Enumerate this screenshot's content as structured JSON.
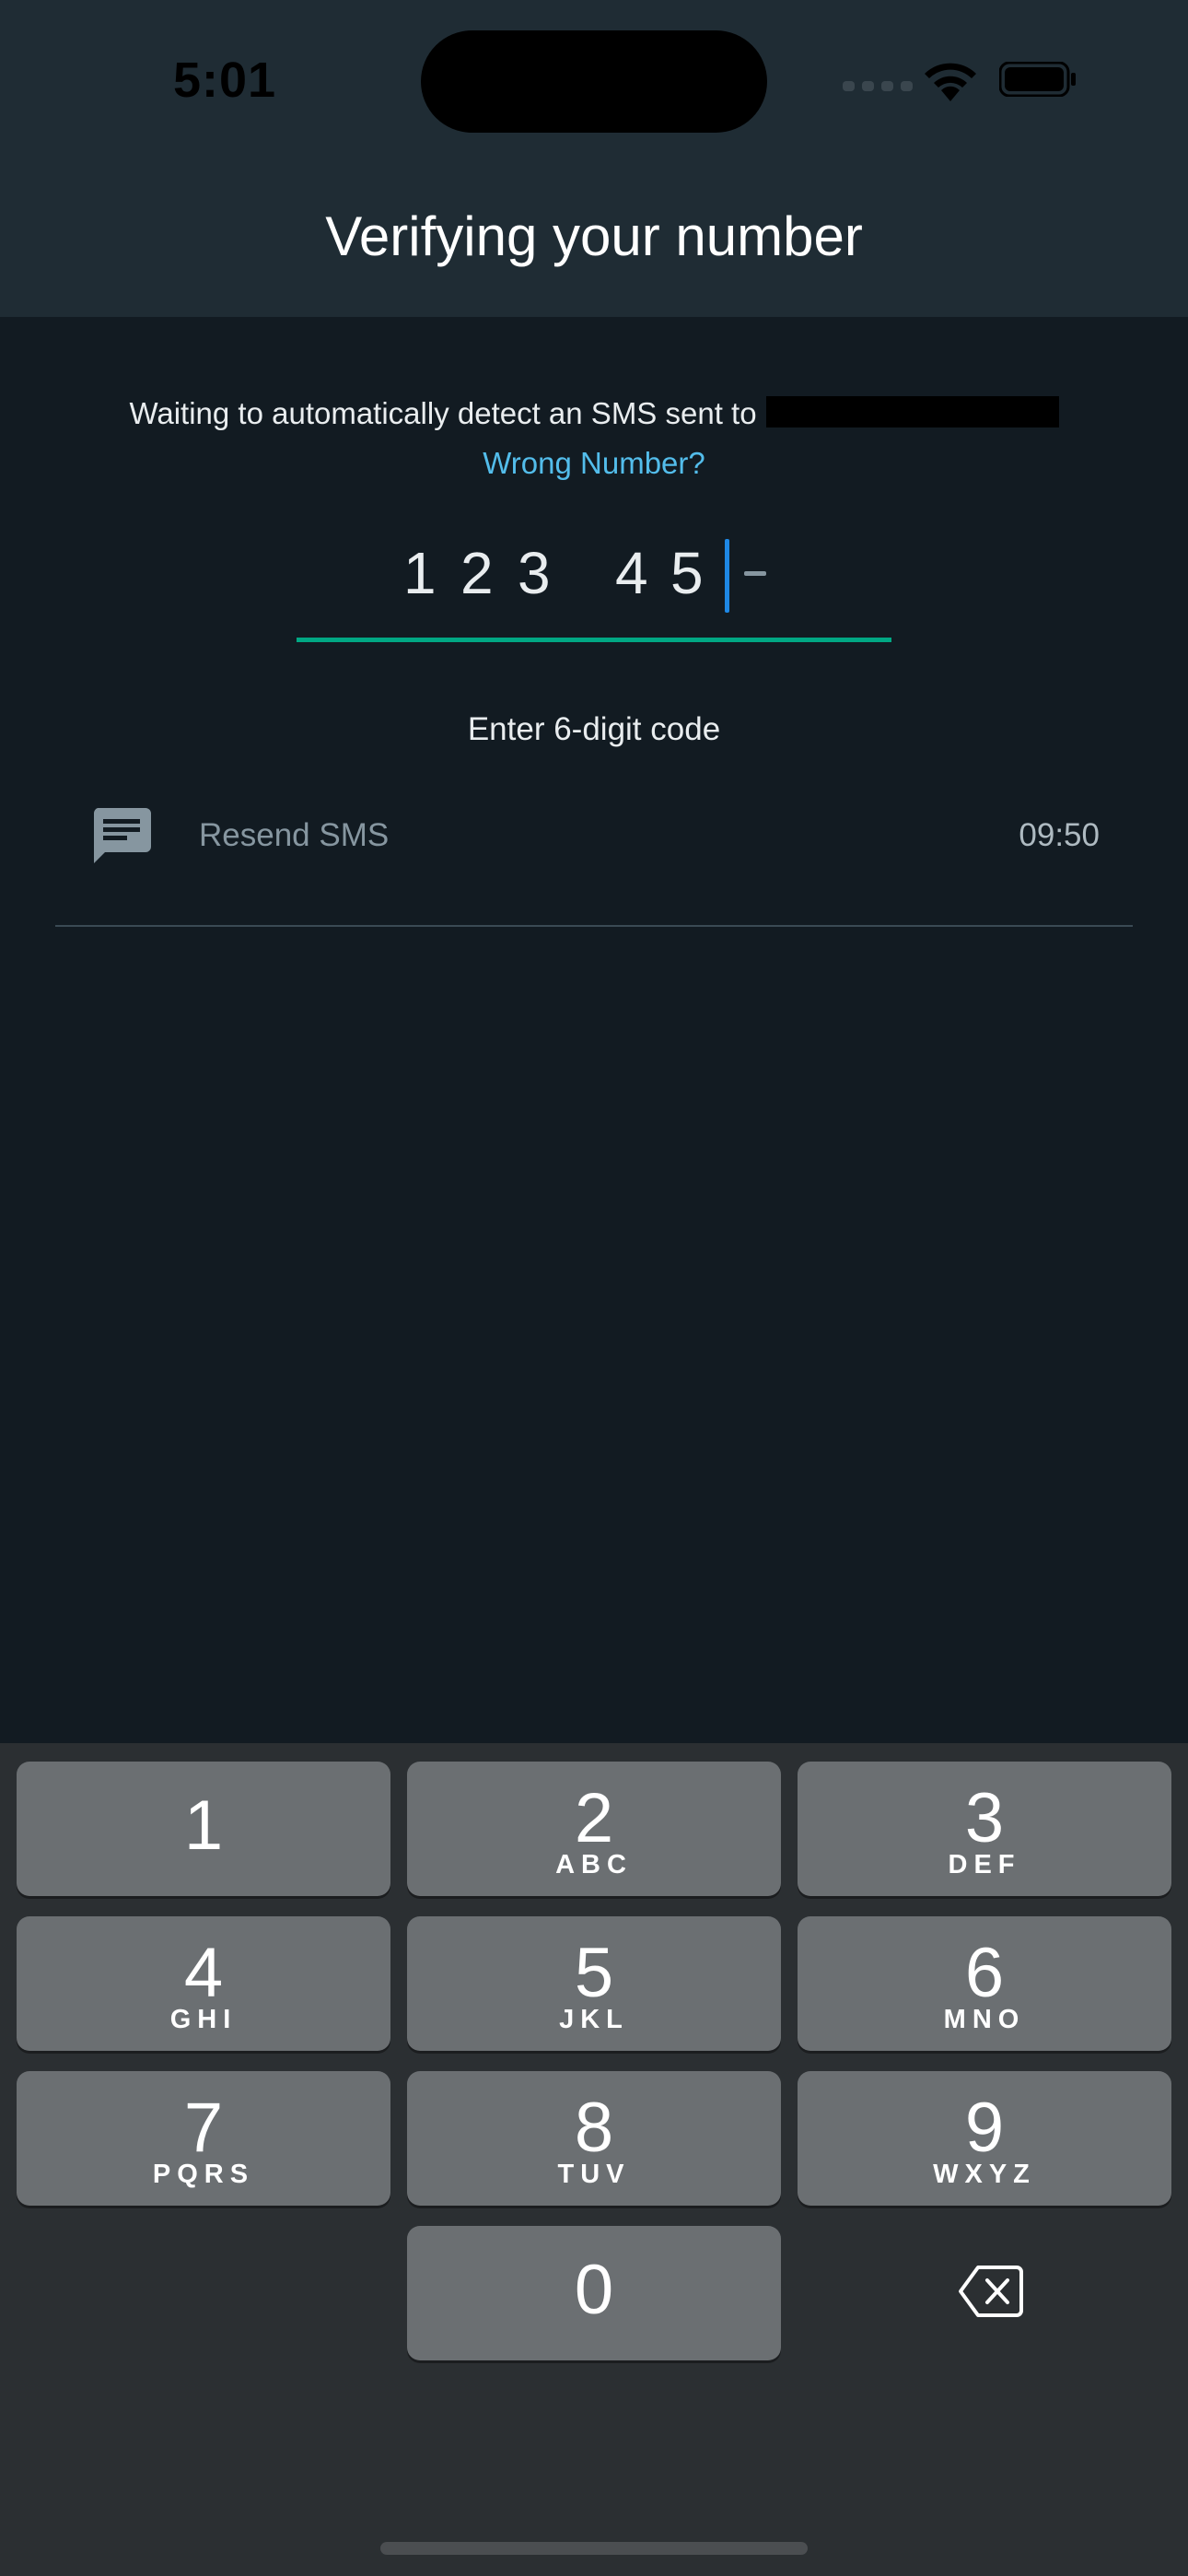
{
  "status": {
    "time": "5:01"
  },
  "header": {
    "title": "Verifying your number"
  },
  "verify": {
    "info_text": "Waiting to automatically detect an SMS sent to",
    "wrong_number": "Wrong Number?",
    "digits": [
      "1",
      "2",
      "3",
      "4",
      "5"
    ],
    "hint": "Enter 6-digit code"
  },
  "resend": {
    "label": "Resend SMS",
    "timer": "09:50"
  },
  "keypad": {
    "keys": [
      {
        "num": "1",
        "letters": ""
      },
      {
        "num": "2",
        "letters": "ABC"
      },
      {
        "num": "3",
        "letters": "DEF"
      },
      {
        "num": "4",
        "letters": "GHI"
      },
      {
        "num": "5",
        "letters": "JKL"
      },
      {
        "num": "6",
        "letters": "MNO"
      },
      {
        "num": "7",
        "letters": "PQRS"
      },
      {
        "num": "8",
        "letters": "TUV"
      },
      {
        "num": "9",
        "letters": "WXYZ"
      },
      {
        "num": "0",
        "letters": ""
      }
    ]
  },
  "colors": {
    "accent": "#00a884",
    "link": "#53bdeb",
    "cursor": "#1e88e5"
  }
}
